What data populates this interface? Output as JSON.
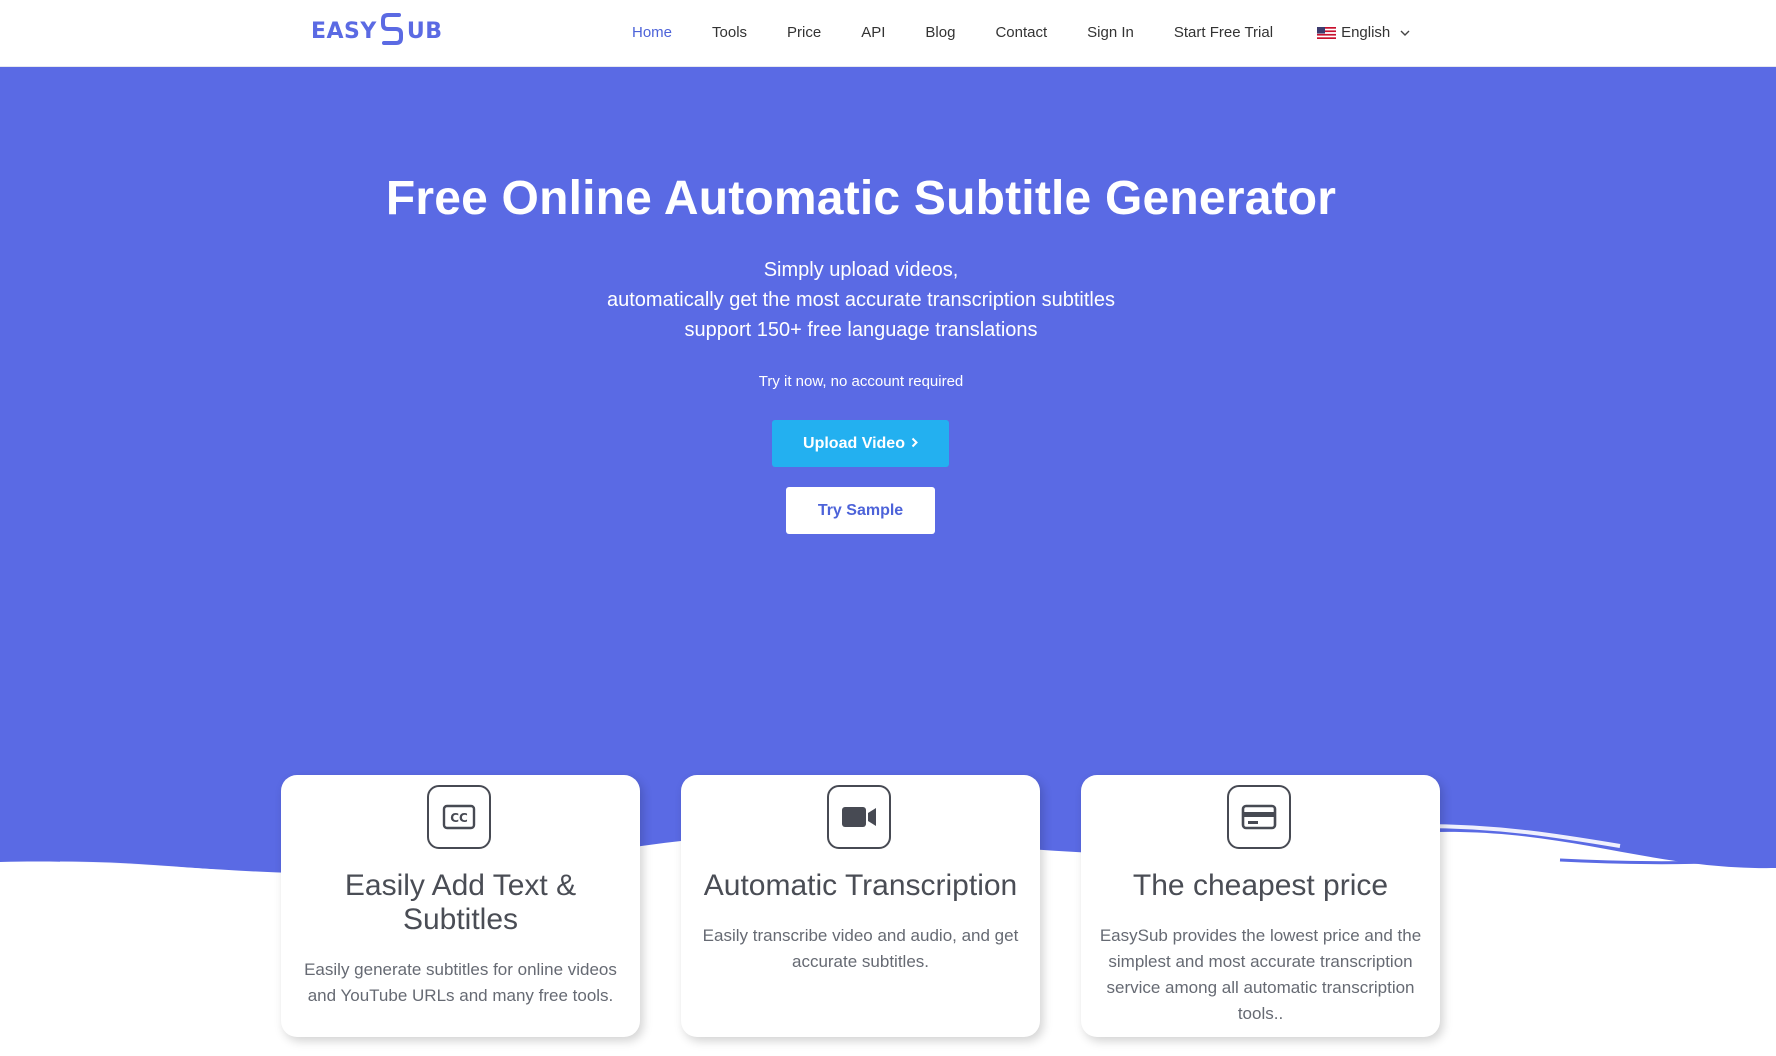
{
  "header": {
    "logo": {
      "left": "EASY",
      "right": "UB"
    },
    "nav": [
      {
        "label": "Home",
        "active": true
      },
      {
        "label": "Tools"
      },
      {
        "label": "Price"
      },
      {
        "label": "API"
      },
      {
        "label": "Blog"
      },
      {
        "label": "Contact"
      },
      {
        "label": "Sign In"
      },
      {
        "label": "Start Free Trial"
      }
    ],
    "language": {
      "label": "English",
      "icon": "us-flag-icon"
    }
  },
  "hero": {
    "title": "Free Online Automatic Subtitle Generator",
    "subtitle_lines": [
      "Simply upload videos,",
      "automatically get the most accurate transcription subtitles",
      "support 150+ free language translations"
    ],
    "note": "Try it now, no account required",
    "upload_label": "Upload Video",
    "sample_label": "Try Sample"
  },
  "features": [
    {
      "icon": "closed-caption-icon",
      "title": "Easily Add Text & Subtitles",
      "description": "Easily generate subtitles for online videos and YouTube URLs and many free tools."
    },
    {
      "icon": "video-camera-icon",
      "title": "Automatic Transcription",
      "description": "Easily transcribe video and audio, and get accurate subtitles."
    },
    {
      "icon": "credit-card-icon",
      "title": "The cheapest price",
      "description": "EasySub provides the lowest price and the simplest and most accurate transcription service among all automatic transcription tools.."
    }
  ],
  "colors": {
    "brand": "#5a6ae4",
    "accent_button": "#23b0f0",
    "nav_active": "#4d63d9"
  }
}
